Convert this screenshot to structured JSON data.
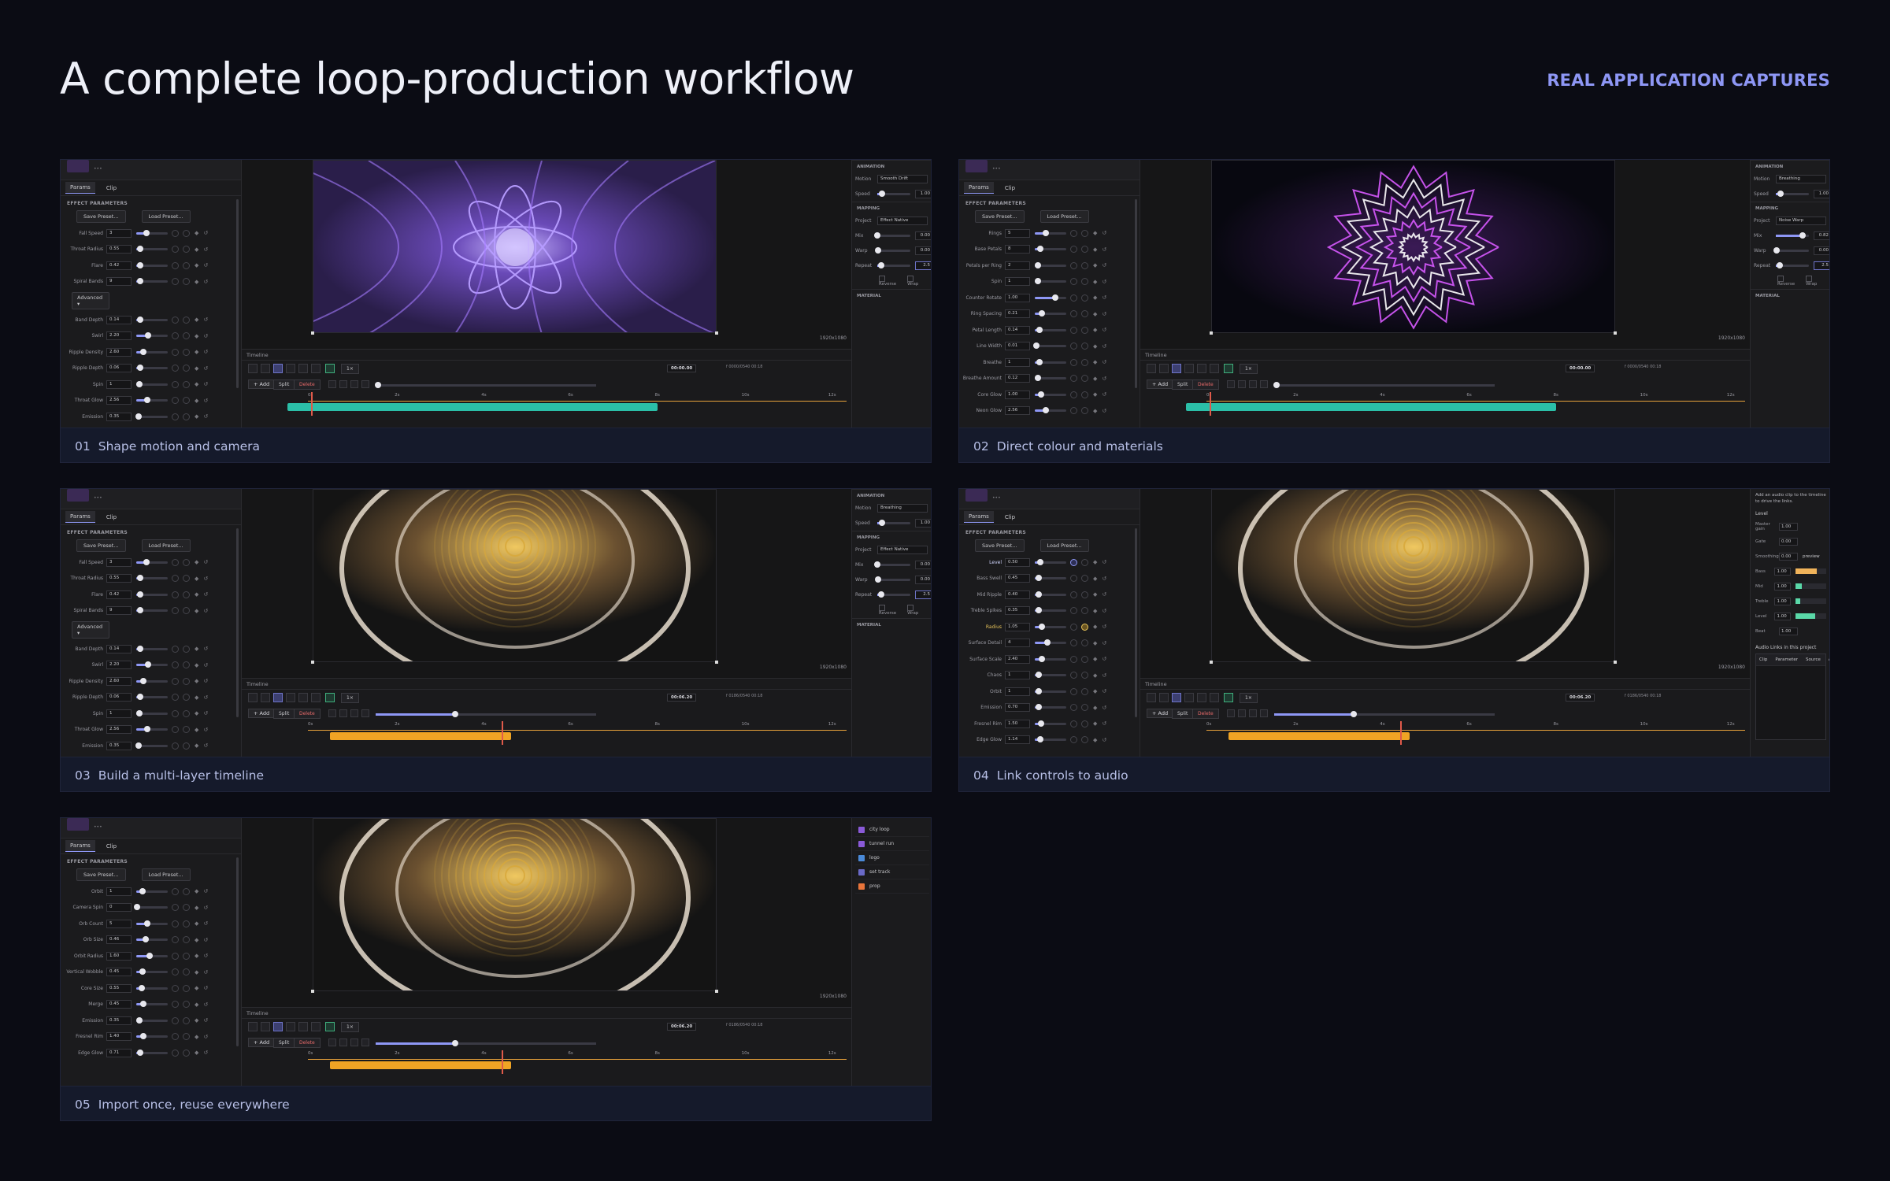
{
  "header": {
    "title": "A complete loop-production workflow",
    "badge": "REAL APPLICATION CAPTURES"
  },
  "captions": [
    {
      "num": "01",
      "text": "Shape motion and camera"
    },
    {
      "num": "02",
      "text": "Direct colour and materials"
    },
    {
      "num": "03",
      "text": "Build a multi-layer timeline"
    },
    {
      "num": "04",
      "text": "Link controls to audio"
    },
    {
      "num": "05",
      "text": "Import once, reuse everywhere"
    }
  ],
  "ui": {
    "tab_params": "Params",
    "tab_clip": "Clip",
    "effect_params": "EFFECT PARAMETERS",
    "save_preset": "Save Preset...",
    "load_preset": "Load Preset...",
    "advanced": "Advanced ▾",
    "timeline": "Timeline",
    "add": "+ Add",
    "split": "Split",
    "delete": "Delete",
    "resolution": "1920x1080",
    "animation": "ANIMATION",
    "mapping": "MAPPING",
    "material": "MATERIAL",
    "motion": "Motion",
    "speed": "Speed",
    "project": "Project",
    "mix": "Mix",
    "warp": "Warp",
    "repeat": "Repeat",
    "reverse": "Reverse",
    "wrap": "Wrap",
    "speed_mult": "1×",
    "ticks": [
      "0s",
      "2s",
      "4s",
      "6s",
      "8s",
      "10s",
      "12s"
    ]
  },
  "panel1": {
    "tc": "00:00.00",
    "tc2": "f 0000/0540 00:18",
    "motion": "Smooth Drift",
    "speed": "1.00",
    "project": "Effect Native",
    "mix": "0.00",
    "warp": "0.00",
    "repeat": "2.5",
    "params": [
      {
        "label": "Fall Speed",
        "value": "3",
        "pos": 0.32
      },
      {
        "label": "Throat Radius",
        "value": "0.55",
        "pos": 0.12
      },
      {
        "label": "Flare",
        "value": "0.42",
        "pos": 0.12
      },
      {
        "label": "Spiral Bands",
        "value": "9",
        "pos": 0.12
      },
      {
        "label": "Band Depth",
        "value": "0.14",
        "pos": 0.12
      },
      {
        "label": "Swirl",
        "value": "2.20",
        "pos": 0.38
      },
      {
        "label": "Ripple Density",
        "value": "2.60",
        "pos": 0.22
      },
      {
        "label": "Ripple Depth",
        "value": "0.06",
        "pos": 0.12
      },
      {
        "label": "Spin",
        "value": "1",
        "pos": 0.1
      },
      {
        "label": "Throat Glow",
        "value": "2.56",
        "pos": 0.36
      },
      {
        "label": "Emission",
        "value": "0.35",
        "pos": 0.08
      }
    ]
  },
  "panel2": {
    "tc": "00:00.00",
    "tc2": "f 0000/0540 00:18",
    "motion": "Breathing",
    "speed": "1.00",
    "project": "Noise Warp",
    "mix": "0.82",
    "warp": "0.00",
    "repeat": "2.5",
    "params": [
      {
        "label": "Rings",
        "value": "5",
        "pos": 0.35
      },
      {
        "label": "Base Petals",
        "value": "8",
        "pos": 0.18
      },
      {
        "label": "Petals per Ring",
        "value": "2",
        "pos": 0.1
      },
      {
        "label": "Spin",
        "value": "1",
        "pos": 0.1
      },
      {
        "label": "Counter Rotate",
        "value": "1.00",
        "pos": 0.66
      },
      {
        "label": "Ring Spacing",
        "value": "0.21",
        "pos": 0.22
      },
      {
        "label": "Petal Length",
        "value": "0.14",
        "pos": 0.16
      },
      {
        "label": "Line Width",
        "value": "0.01",
        "pos": 0.04
      },
      {
        "label": "Breathe",
        "value": "1",
        "pos": 0.14
      },
      {
        "label": "Breathe Amount",
        "value": "0.12",
        "pos": 0.1
      },
      {
        "label": "Core Glow",
        "value": "1.00",
        "pos": 0.2
      },
      {
        "label": "Neon Glow",
        "value": "2.56",
        "pos": 0.36
      }
    ]
  },
  "panel3": {
    "tc": "00:06.20",
    "tc2": "f 0186/0540 00:18",
    "motion": "Breathing",
    "speed": "1.00",
    "project": "Effect Native",
    "mix": "0.00",
    "warp": "0.00",
    "repeat": "2.5",
    "params": [
      {
        "label": "Fall Speed",
        "value": "3",
        "pos": 0.32
      },
      {
        "label": "Throat Radius",
        "value": "0.55",
        "pos": 0.12
      },
      {
        "label": "Flare",
        "value": "0.42",
        "pos": 0.12
      },
      {
        "label": "Spiral Bands",
        "value": "9",
        "pos": 0.12
      },
      {
        "label": "Band Depth",
        "value": "0.14",
        "pos": 0.12
      },
      {
        "label": "Swirl",
        "value": "2.20",
        "pos": 0.38
      },
      {
        "label": "Ripple Density",
        "value": "2.60",
        "pos": 0.22
      },
      {
        "label": "Ripple Depth",
        "value": "0.06",
        "pos": 0.12
      },
      {
        "label": "Spin",
        "value": "1",
        "pos": 0.1
      },
      {
        "label": "Throat Glow",
        "value": "2.56",
        "pos": 0.36
      },
      {
        "label": "Emission",
        "value": "0.35",
        "pos": 0.08
      }
    ]
  },
  "panel4": {
    "tc": "00:06.20",
    "tc2": "f 0186/0540 00:18",
    "note": "Add an audio clip to the timeline to drive the links.",
    "level_title": "Level",
    "links_title": "Audio Links in this project",
    "link_cols": [
      "Clip",
      "Parameter",
      "Source",
      "Amount"
    ],
    "audio": [
      {
        "label": "Master gain",
        "value": "1.00",
        "bar": 0,
        "color": ""
      },
      {
        "label": "Gate",
        "value": "0.00",
        "bar": 0,
        "color": ""
      },
      {
        "label": "Smoothing",
        "value": "0.00",
        "bar": 0,
        "color": "",
        "extra": "preview"
      },
      {
        "label": "Bass",
        "value": "1.00",
        "bar": 0.7,
        "color": "#f0b35a"
      },
      {
        "label": "Mid",
        "value": "1.00",
        "bar": 0.22,
        "color": "#5ad8a8"
      },
      {
        "label": "Treble",
        "value": "1.00",
        "bar": 0.16,
        "color": "#5ad8a8"
      },
      {
        "label": "Level",
        "value": "1.00",
        "bar": 0.65,
        "color": "#5ad8a8"
      },
      {
        "label": "Beat",
        "value": "1.00",
        "bar": 0,
        "color": ""
      }
    ],
    "params": [
      {
        "label": "Level",
        "value": "0.50",
        "pos": 0.18,
        "hl": "b"
      },
      {
        "label": "Bass Swell",
        "value": "0.45",
        "pos": 0.12
      },
      {
        "label": "Mid Ripple",
        "value": "0.40",
        "pos": 0.12
      },
      {
        "label": "Treble Spikes",
        "value": "0.35",
        "pos": 0.12
      },
      {
        "label": "Radius",
        "value": "1.05",
        "pos": 0.22,
        "hl": "g"
      },
      {
        "label": "Surface Detail",
        "value": "4",
        "pos": 0.4
      },
      {
        "label": "Surface Scale",
        "value": "2.40",
        "pos": 0.22
      },
      {
        "label": "Chaos",
        "value": "1",
        "pos": 0.12
      },
      {
        "label": "Orbit",
        "value": "1",
        "pos": 0.12
      },
      {
        "label": "Emission",
        "value": "0.70",
        "pos": 0.12
      },
      {
        "label": "Fresnel Rim",
        "value": "1.50",
        "pos": 0.2
      },
      {
        "label": "Edge Glow",
        "value": "1.14",
        "pos": 0.18
      }
    ]
  },
  "panel5": {
    "tc": "00:06.20",
    "tc2": "f 0186/0540 00:18",
    "library": [
      {
        "label": "city loop",
        "color": "#8a5ad8"
      },
      {
        "label": "tunnel run",
        "color": "#8a5ad8"
      },
      {
        "label": "logo",
        "color": "#4a8ad8"
      },
      {
        "label": "set track",
        "color": "#6a6ac8"
      },
      {
        "label": "prop",
        "color": "#e8743a"
      }
    ],
    "params": [
      {
        "label": "Orbit",
        "value": "1",
        "pos": 0.2
      },
      {
        "label": "Camera Spin",
        "value": "0",
        "pos": 0.02
      },
      {
        "label": "Orb Count",
        "value": "5",
        "pos": 0.34
      },
      {
        "label": "Orb Size",
        "value": "0.46",
        "pos": 0.3
      },
      {
        "label": "Orbit Radius",
        "value": "1.60",
        "pos": 0.42
      },
      {
        "label": "Vertical Wobble",
        "value": "0.45",
        "pos": 0.2
      },
      {
        "label": "Core Size",
        "value": "0.55",
        "pos": 0.18
      },
      {
        "label": "Merge",
        "value": "0.45",
        "pos": 0.22
      },
      {
        "label": "Emission",
        "value": "0.35",
        "pos": 0.1
      },
      {
        "label": "Fresnel Rim",
        "value": "1.40",
        "pos": 0.22
      },
      {
        "label": "Edge Glow",
        "value": "0.71",
        "pos": 0.12
      }
    ]
  }
}
